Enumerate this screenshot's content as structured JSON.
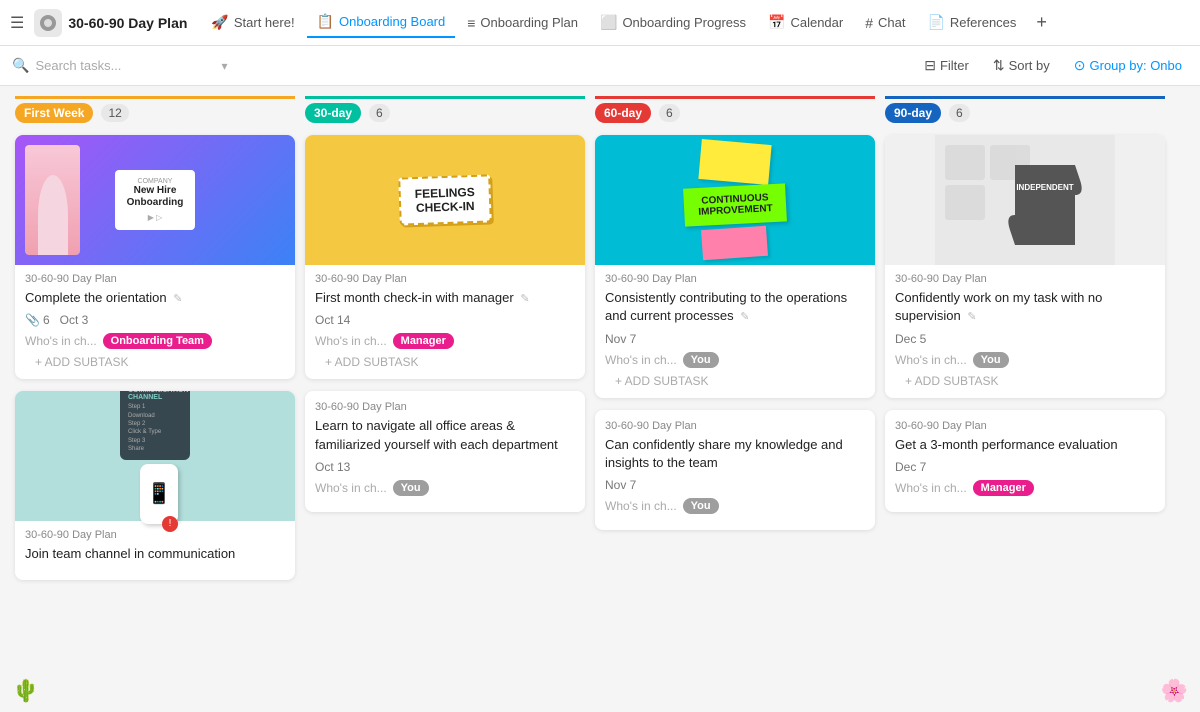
{
  "app": {
    "icon": "☰",
    "project_icon": "⚙",
    "project_title": "30-60-90 Day Plan"
  },
  "nav": {
    "tabs": [
      {
        "id": "start",
        "icon": "🚀",
        "label": "Start here!",
        "active": false
      },
      {
        "id": "board",
        "icon": "📋",
        "label": "Onboarding Board",
        "active": true
      },
      {
        "id": "plan",
        "icon": "≡",
        "label": "Onboarding Plan",
        "active": false
      },
      {
        "id": "progress",
        "icon": "⬜",
        "label": "Onboarding Progress",
        "active": false
      },
      {
        "id": "calendar",
        "icon": "📅",
        "label": "Calendar",
        "active": false
      },
      {
        "id": "chat",
        "icon": "#",
        "label": "Chat",
        "active": false
      },
      {
        "id": "references",
        "icon": "📄",
        "label": "References",
        "active": false
      }
    ],
    "more_icon": "+"
  },
  "toolbar": {
    "search_placeholder": "Search tasks...",
    "filter_label": "Filter",
    "sort_label": "Sort by",
    "group_label": "Group by: Onbo"
  },
  "columns": [
    {
      "id": "first-week",
      "label": "First Week",
      "color": "yellow",
      "count": 12,
      "cards": [
        {
          "id": "c1",
          "project": "30-60-90 Day Plan",
          "title": "Complete the orientation",
          "has_image": true,
          "image_type": "onboarding",
          "subtask_count": 6,
          "date": "Oct 3",
          "assignee": "Onboarding Team",
          "assignee_color": "pink",
          "who_label": "Who's in ch..."
        },
        {
          "id": "c2",
          "project": "30-60-90 Day Plan",
          "title": "Join team channel in communication",
          "has_image": true,
          "image_type": "communication",
          "subtask_count": null,
          "date": null,
          "assignee": null,
          "who_label": null
        }
      ]
    },
    {
      "id": "thirty-day",
      "label": "30-day",
      "color": "teal",
      "count": 6,
      "cards": [
        {
          "id": "c3",
          "project": "30-60-90 Day Plan",
          "title": "First month check-in with manager",
          "has_image": true,
          "image_type": "checkin",
          "subtask_count": null,
          "date": "Oct 14",
          "assignee": "Manager",
          "assignee_color": "pink",
          "who_label": "Who's in ch..."
        },
        {
          "id": "c4",
          "project": "30-60-90 Day Plan",
          "title": "Learn to navigate all office areas & familiarized yourself with each department",
          "has_image": false,
          "image_type": null,
          "subtask_count": null,
          "date": "Oct 13",
          "assignee": "You",
          "assignee_color": "gray",
          "who_label": "Who's in ch..."
        }
      ]
    },
    {
      "id": "sixty-day",
      "label": "60-day",
      "color": "red",
      "count": 6,
      "cards": [
        {
          "id": "c5",
          "project": "30-60-90 Day Plan",
          "title": "Consistently contributing to the operations and current processes",
          "has_image": true,
          "image_type": "continuous",
          "subtask_count": null,
          "date": "Nov 7",
          "assignee": "You",
          "assignee_color": "gray",
          "who_label": "Who's in ch..."
        },
        {
          "id": "c6",
          "project": "30-60-90 Day Plan",
          "title": "Can confidently share my knowledge and insights to the team",
          "has_image": false,
          "image_type": null,
          "subtask_count": null,
          "date": "Nov 7",
          "assignee": "You",
          "assignee_color": "gray",
          "who_label": "Who's in ch..."
        }
      ]
    },
    {
      "id": "ninety-day",
      "label": "90-day",
      "color": "blue",
      "count": 6,
      "cards": [
        {
          "id": "c7",
          "project": "30-60-90 Day Plan",
          "title": "Confidently work on my task with no supervision",
          "has_image": true,
          "image_type": "puzzle",
          "subtask_count": null,
          "date": "Dec 5",
          "assignee": "You",
          "assignee_color": "gray",
          "who_label": "Who's in ch..."
        },
        {
          "id": "c8",
          "project": "30-60-90 Day Plan",
          "title": "Get a 3-month performance evaluation",
          "has_image": false,
          "image_type": null,
          "subtask_count": null,
          "date": "Dec 7",
          "assignee": "Manager",
          "assignee_color": "pink",
          "who_label": "Who's in ch..."
        }
      ]
    }
  ],
  "labels": {
    "add_subtask": "+ ADD SUBTASK",
    "who_in_charge": "Who's in ch...",
    "filter": "Filter",
    "sort_by": "Sort by",
    "group_by": "Group by: Onbo"
  }
}
